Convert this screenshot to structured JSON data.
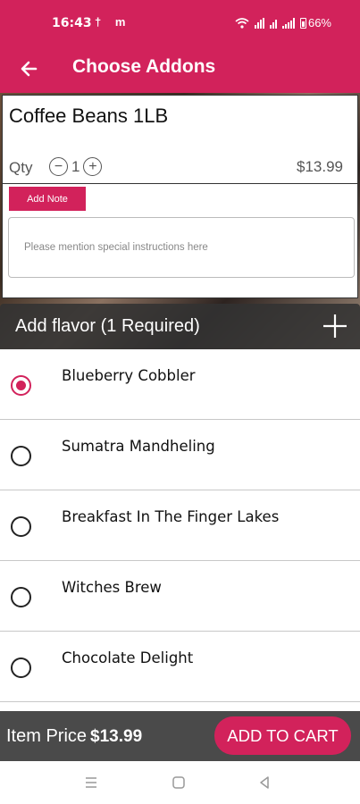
{
  "status_bar": {
    "time": "16:43",
    "left_icons": "† m",
    "battery": "66%"
  },
  "app_bar": {
    "title": "Choose Addons"
  },
  "product": {
    "name": "Coffee Beans 1LB",
    "qty_label": "Qty",
    "qty_value": "1",
    "price": "$13.99"
  },
  "note": {
    "button_label": "Add Note",
    "placeholder": "Please mention special instructions here"
  },
  "flavor_section": {
    "title": "Add flavor (1 Required)",
    "options": [
      {
        "label": "Blueberry Cobbler",
        "selected": true
      },
      {
        "label": "Sumatra Mandheling",
        "selected": false
      },
      {
        "label": "Breakfast In The Finger Lakes",
        "selected": false
      },
      {
        "label": "Witches Brew",
        "selected": false
      },
      {
        "label": "Chocolate Delight",
        "selected": false
      }
    ]
  },
  "footer": {
    "item_price_label": "Item Price",
    "item_price_value": "$13.99",
    "add_to_cart": "ADD TO CART"
  },
  "colors": {
    "accent": "#d2225b",
    "footer_bg": "#4a4a4a"
  }
}
